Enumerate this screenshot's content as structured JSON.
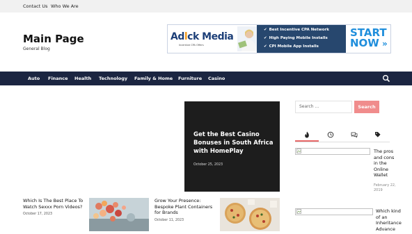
{
  "topbar": {
    "links": [
      "Contact Us",
      "Who We Are"
    ]
  },
  "site": {
    "title": "Main Page",
    "tagline": "General Blog"
  },
  "banner": {
    "logo_pre": "Ad",
    "logo_o": "l",
    "logo_post": "ck Media",
    "tagline": "Incentive CPA Offers",
    "bullets": [
      "Best Incentive CPA Network",
      "High Paying Mobile Installs",
      "CPI Mobile App Installs"
    ],
    "cta_line1": "START",
    "cta_line2": "NOW"
  },
  "nav": {
    "items": [
      "Auto",
      "Finance",
      "Health",
      "Technology",
      "Family & Home",
      "Furniture",
      "Casino"
    ]
  },
  "hero": {
    "title": "Get the Best Casino Bonuses in South Africa with HomePlay",
    "date": "October 25, 2023"
  },
  "posts": [
    {
      "title": "Which Is The Best Place To Watch Sexxx Porn Videos?",
      "date": "October 17, 2023"
    },
    {
      "title": "Grow Your Presence: Bespoke Plant Containers for Brands",
      "date": "October 11, 2023"
    }
  ],
  "sidebar": {
    "search_placeholder": "Search ...",
    "search_button": "Search",
    "tab_icons": [
      "fire-icon",
      "clock-icon",
      "comments-icon",
      "tags-icon"
    ],
    "items": [
      {
        "title": "The pros and cons in the Online Wallet",
        "date": "February 22, 2019"
      },
      {
        "title": "Which kind of an Inheritance Advance",
        "date": ""
      }
    ]
  },
  "colors": {
    "topbar": "#f1f1f1",
    "navbar": "#1b2541",
    "accent": "#e76767",
    "search_button": "#f08c8c",
    "hero_bg": "#1d1d1d"
  }
}
